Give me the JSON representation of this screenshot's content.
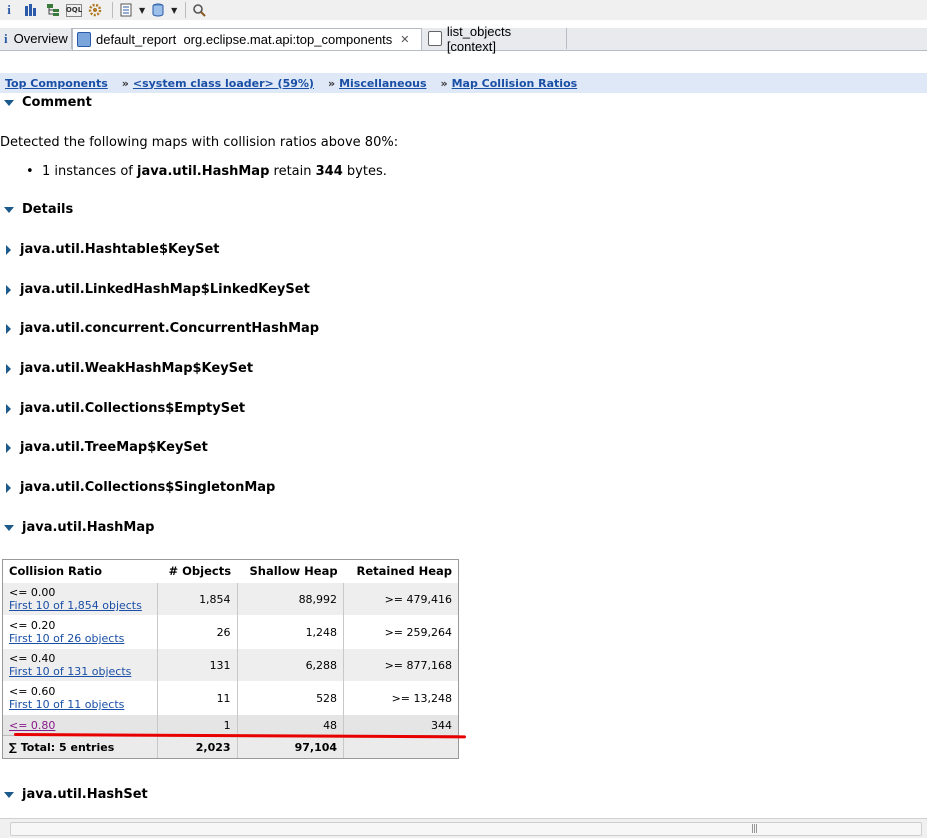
{
  "toolbar": {
    "icons": [
      "info-icon",
      "histogram-icon",
      "dominator-tree-icon",
      "oql-icon",
      "gear-icon",
      "report-icon",
      "database-icon",
      "search-icon"
    ],
    "oql_label": "OQL"
  },
  "tabs": [
    {
      "label": "Overview"
    },
    {
      "label": "default_report  org.eclipse.mat.api:top_components"
    },
    {
      "label": "list_objects [context]"
    }
  ],
  "breadcrumb": {
    "items": [
      "Top Components",
      "<system class loader> (59%)",
      "Miscellaneous",
      "Map Collision Ratios"
    ],
    "sep": "»"
  },
  "comment": {
    "heading": "Comment",
    "text": "Detected the following maps with collision ratios above 80%:",
    "bullet": {
      "pre": "1 instances of ",
      "cls": "java.util.HashMap",
      "mid": " retain ",
      "num": "344",
      "post": " bytes."
    }
  },
  "details": {
    "heading": "Details",
    "collapsed": [
      "java.util.Hashtable$KeySet",
      "java.util.LinkedHashMap$LinkedKeySet",
      "java.util.concurrent.ConcurrentHashMap",
      "java.util.WeakHashMap$KeySet",
      "java.util.Collections$EmptySet",
      "java.util.TreeMap$KeySet",
      "java.util.Collections$SingletonMap"
    ],
    "expanded": "java.util.HashMap",
    "last": "java.util.HashSet"
  },
  "table": {
    "headers": [
      "Collision Ratio",
      "# Objects",
      "Shallow Heap",
      "Retained Heap"
    ],
    "rows": [
      {
        "ratio": "<= 0.00",
        "link": "First 10 of 1,854 objects",
        "objects": "1,854",
        "shallow": "88,992",
        "retained": ">= 479,416"
      },
      {
        "ratio": "<= 0.20",
        "link": "First 10 of 26 objects",
        "objects": "26",
        "shallow": "1,248",
        "retained": ">= 259,264"
      },
      {
        "ratio": "<= 0.40",
        "link": "First 10 of 131 objects",
        "objects": "131",
        "shallow": "6,288",
        "retained": ">= 877,168"
      },
      {
        "ratio": "<= 0.60",
        "link": "First 10 of 11 objects",
        "objects": "11",
        "shallow": "528",
        "retained": ">= 13,248"
      },
      {
        "ratio": "<= 0.80",
        "link": "",
        "objects": "1",
        "shallow": "48",
        "retained": "344"
      }
    ],
    "total": {
      "label": "∑ Total: 5 entries",
      "objects": "2,023",
      "shallow": "97,104",
      "retained": ""
    }
  },
  "colors": {
    "link": "#1a4fa6",
    "visited": "#8b1a8b",
    "annotation": "#e80000"
  }
}
